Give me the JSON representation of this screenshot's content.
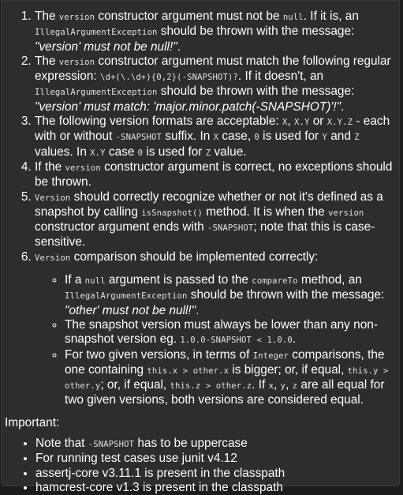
{
  "requirements": [
    {
      "segments": [
        {
          "t": "text",
          "v": "The "
        },
        {
          "t": "code",
          "v": "version"
        },
        {
          "t": "text",
          "v": " constructor argument must not be "
        },
        {
          "t": "code",
          "v": "null"
        },
        {
          "t": "text",
          "v": ". If it is, an "
        },
        {
          "t": "code",
          "v": "IllegalArgumentException"
        },
        {
          "t": "text",
          "v": " should be thrown with the message: "
        },
        {
          "t": "em",
          "v": "\"version' must not be null!\""
        },
        {
          "t": "text",
          "v": "."
        }
      ]
    },
    {
      "segments": [
        {
          "t": "text",
          "v": "The "
        },
        {
          "t": "code",
          "v": "version"
        },
        {
          "t": "text",
          "v": " constructor argument must match the following regular expression: "
        },
        {
          "t": "code",
          "v": "\\d+(\\.\\d+){0,2}(-SNAPSHOT)?"
        },
        {
          "t": "text",
          "v": ". If it doesn't, an "
        },
        {
          "t": "code",
          "v": "IllegalArgumentException"
        },
        {
          "t": "text",
          "v": " should be thrown with the message: "
        },
        {
          "t": "em",
          "v": "\"version' must match: 'major.minor.patch(-SNAPSHOT)'!\""
        },
        {
          "t": "text",
          "v": "."
        }
      ]
    },
    {
      "segments": [
        {
          "t": "text",
          "v": "The following version formats are acceptable: "
        },
        {
          "t": "code",
          "v": "X"
        },
        {
          "t": "text",
          "v": ", "
        },
        {
          "t": "code",
          "v": "X.Y"
        },
        {
          "t": "text",
          "v": " or "
        },
        {
          "t": "code",
          "v": "X.Y.Z"
        },
        {
          "t": "text",
          "v": " - each with or without "
        },
        {
          "t": "code",
          "v": "-SNAPSHOT"
        },
        {
          "t": "text",
          "v": " suffix. In "
        },
        {
          "t": "code",
          "v": "X"
        },
        {
          "t": "text",
          "v": " case, "
        },
        {
          "t": "code",
          "v": "0"
        },
        {
          "t": "text",
          "v": " is used for "
        },
        {
          "t": "code",
          "v": "Y"
        },
        {
          "t": "text",
          "v": " and "
        },
        {
          "t": "code",
          "v": "Z"
        },
        {
          "t": "text",
          "v": " values. In "
        },
        {
          "t": "code",
          "v": "X.Y"
        },
        {
          "t": "text",
          "v": " case "
        },
        {
          "t": "code",
          "v": "0"
        },
        {
          "t": "text",
          "v": " is used for "
        },
        {
          "t": "code",
          "v": "Z"
        },
        {
          "t": "text",
          "v": " value."
        }
      ]
    },
    {
      "segments": [
        {
          "t": "text",
          "v": "If the "
        },
        {
          "t": "code",
          "v": "version"
        },
        {
          "t": "text",
          "v": " constructor argument is correct, no exceptions should be thrown."
        }
      ]
    },
    {
      "segments": [
        {
          "t": "code",
          "v": "Version"
        },
        {
          "t": "text",
          "v": " should correctly recognize whether or not it's defined as a snapshot by calling "
        },
        {
          "t": "code",
          "v": "isSnapshot()"
        },
        {
          "t": "text",
          "v": " method. It is when the "
        },
        {
          "t": "code",
          "v": "version"
        },
        {
          "t": "text",
          "v": " constructor argument ends with "
        },
        {
          "t": "code",
          "v": "-SNAPSHOT"
        },
        {
          "t": "text",
          "v": "; note that this is case-sensitive."
        }
      ]
    },
    {
      "segments": [
        {
          "t": "code",
          "v": "Version"
        },
        {
          "t": "text",
          "v": " comparison should be implemented correctly:"
        }
      ],
      "sub": [
        [
          {
            "t": "text",
            "v": "If a "
          },
          {
            "t": "code",
            "v": "null"
          },
          {
            "t": "text",
            "v": " argument is passed to the "
          },
          {
            "t": "code",
            "v": "compareTo"
          },
          {
            "t": "text",
            "v": " method, an "
          },
          {
            "t": "code",
            "v": "IllegalArgumentException"
          },
          {
            "t": "text",
            "v": " should be thrown with the message: "
          },
          {
            "t": "em",
            "v": "\"other' must not be null!\""
          },
          {
            "t": "text",
            "v": "."
          }
        ],
        [
          {
            "t": "text",
            "v": "The snapshot version must always be lower than any non-snapshot version eg. "
          },
          {
            "t": "code",
            "v": "1.0.0-SNAPSHOT < 1.0.0"
          },
          {
            "t": "text",
            "v": "."
          }
        ],
        [
          {
            "t": "text",
            "v": "For two given versions, in terms of "
          },
          {
            "t": "code",
            "v": "Integer"
          },
          {
            "t": "text",
            "v": " comparisons, the one containing "
          },
          {
            "t": "code",
            "v": "this.x > other.x"
          },
          {
            "t": "text",
            "v": " is bigger; or, if equal, "
          },
          {
            "t": "code",
            "v": "this.y > other.y"
          },
          {
            "t": "text",
            "v": "; or, if equal, "
          },
          {
            "t": "code",
            "v": "this.z > other.z"
          },
          {
            "t": "text",
            "v": ". If "
          },
          {
            "t": "code",
            "v": "x"
          },
          {
            "t": "text",
            "v": ", "
          },
          {
            "t": "code",
            "v": "y"
          },
          {
            "t": "text",
            "v": ", "
          },
          {
            "t": "code",
            "v": "z"
          },
          {
            "t": "text",
            "v": " are all equal for two given versions, both versions are considered equal."
          }
        ]
      ]
    }
  ],
  "important": {
    "heading": "Important:",
    "items": [
      [
        {
          "t": "text",
          "v": "Note that "
        },
        {
          "t": "code",
          "v": "-SNAPSHOT"
        },
        {
          "t": "text",
          "v": " has to be uppercase"
        }
      ],
      [
        {
          "t": "text",
          "v": "For running test cases use junit v4.12"
        }
      ],
      [
        {
          "t": "text",
          "v": "assertj-core v3.11.1 is present in the classpath"
        }
      ],
      [
        {
          "t": "text",
          "v": "hamcrest-core v1.3 is present in the classpath"
        }
      ]
    ]
  }
}
